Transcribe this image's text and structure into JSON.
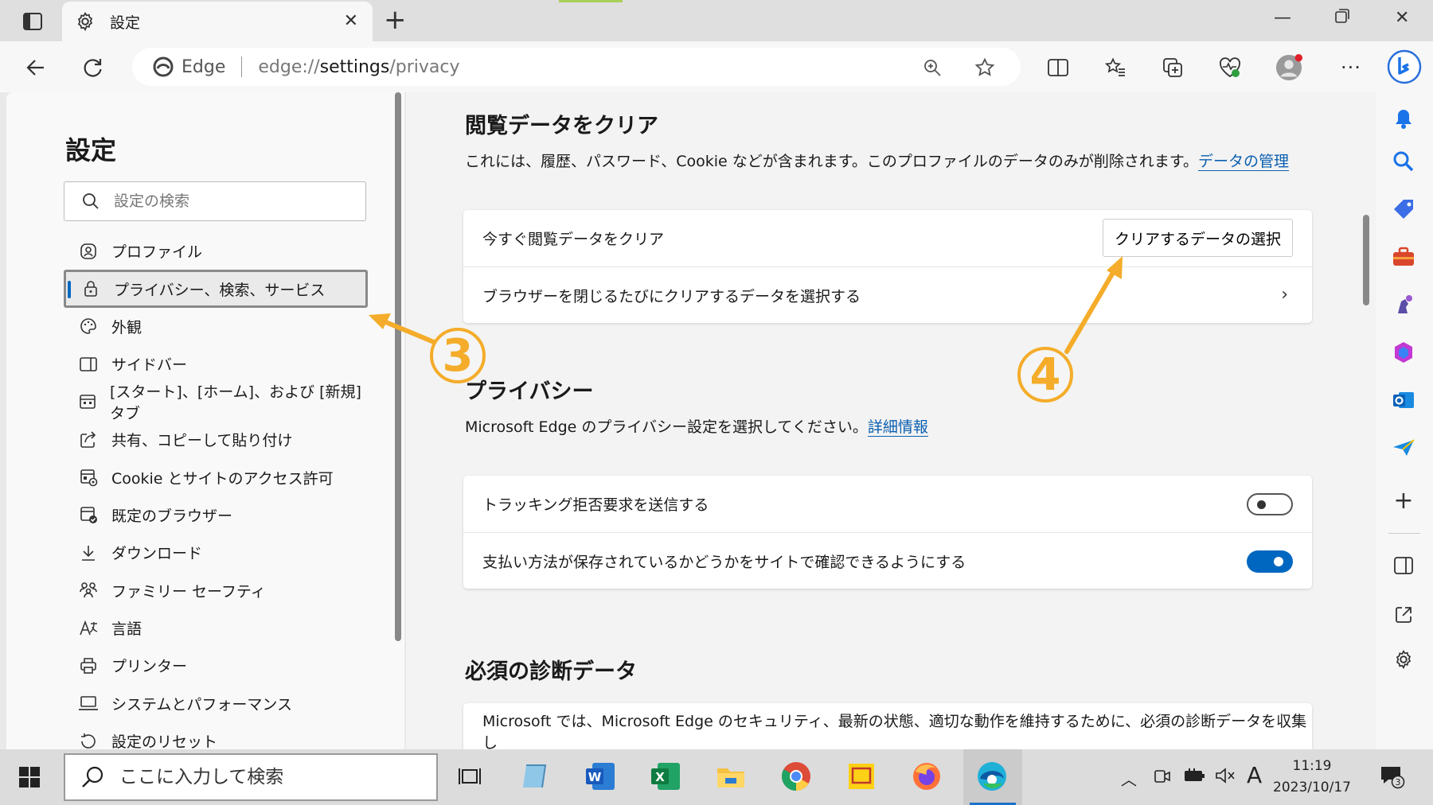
{
  "tab": {
    "title": "設定",
    "close": "✕"
  },
  "address": {
    "brand": "Edge",
    "url_prefix": "edge://",
    "url_host": "settings",
    "url_path": "/privacy"
  },
  "left_panel": {
    "title": "設定",
    "search_placeholder": "設定の検索",
    "items": [
      {
        "label": "プロファイル",
        "icon": "profile-icon"
      },
      {
        "label": "プライバシー、検索、サービス",
        "icon": "lock-icon",
        "active": true
      },
      {
        "label": "外観",
        "icon": "palette-icon"
      },
      {
        "label": "サイドバー",
        "icon": "sidebar-icon"
      },
      {
        "label": "[スタート]、[ホーム]、および [新規] タブ",
        "icon": "home-tabs-icon"
      },
      {
        "label": "共有、コピーして貼り付け",
        "icon": "share-icon"
      },
      {
        "label": "Cookie とサイトのアクセス許可",
        "icon": "cookie-icon"
      },
      {
        "label": "既定のブラウザー",
        "icon": "default-browser-icon"
      },
      {
        "label": "ダウンロード",
        "icon": "download-icon"
      },
      {
        "label": "ファミリー セーフティ",
        "icon": "family-icon"
      },
      {
        "label": "言語",
        "icon": "language-icon"
      },
      {
        "label": "プリンター",
        "icon": "printer-icon"
      },
      {
        "label": "システムとパフォーマンス",
        "icon": "laptop-icon"
      },
      {
        "label": "設定のリセット",
        "icon": "reset-icon"
      }
    ]
  },
  "main": {
    "clear": {
      "title": "閲覧データをクリア",
      "desc": "これには、履歴、パスワード、Cookie などが含まれます。このプロファイルのデータのみが削除されます。",
      "link": "データの管理",
      "row1": "今すぐ閲覧データをクリア",
      "button": "クリアするデータの選択",
      "row2": "ブラウザーを閉じるたびにクリアするデータを選択する"
    },
    "privacy": {
      "title": "プライバシー",
      "desc": "Microsoft Edge のプライバシー設定を選択してください。",
      "link": "詳細情報",
      "row1": "トラッキング拒否要求を送信する",
      "row2": "支払い方法が保存されているかどうかをサイトで確認できるようにする",
      "toggle1_on": false,
      "toggle2_on": true
    },
    "diagnostics": {
      "title": "必須の診断データ",
      "row1": "Microsoft では、Microsoft Edge のセキュリティ、最新の状態、適切な動作を維持するために、必須の診断データを収集し"
    }
  },
  "annotations": {
    "step3": "3",
    "step4": "4",
    "color": "#f4ac2a"
  },
  "taskbar": {
    "search_placeholder": "ここに入力して検索",
    "time": "11:19",
    "date": "2023/10/17",
    "ime": "A",
    "notification_count": "3"
  }
}
